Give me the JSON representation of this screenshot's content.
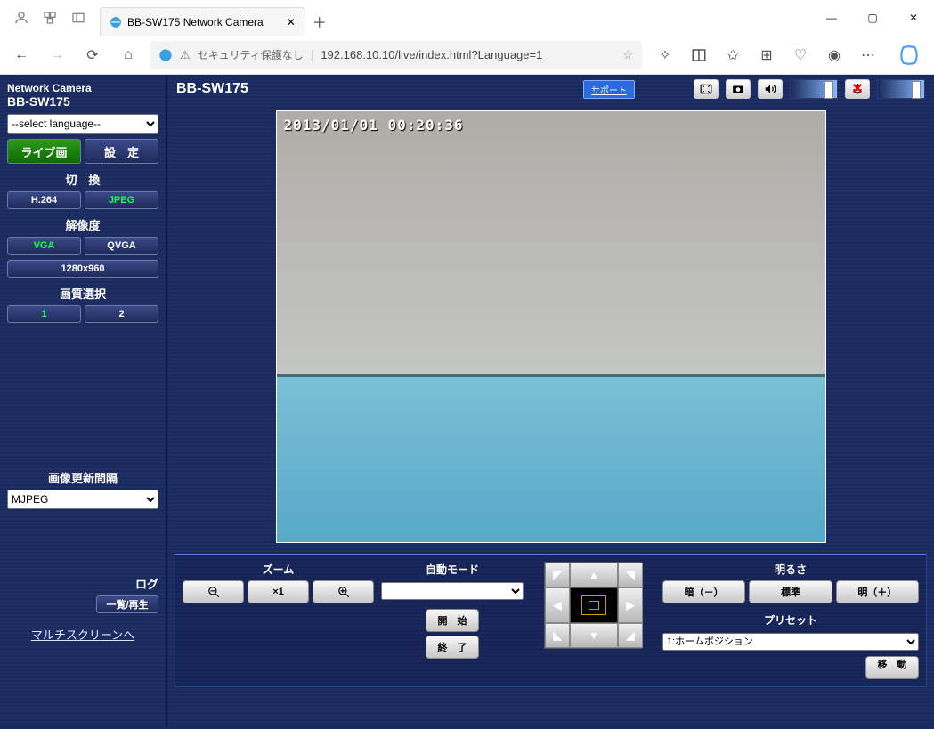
{
  "browser": {
    "tab_title": "BB-SW175 Network Camera",
    "url": "192.168.10.10/live/index.html?Language=1",
    "security_text": "セキュリティ保護なし"
  },
  "sidebar": {
    "title": "Network Camera",
    "model": "BB-SW175",
    "lang_placeholder": "--select language--",
    "live_btn": "ライブ画",
    "setup_btn": "設　定",
    "switch_label": "切　換",
    "h264": "H.264",
    "jpeg": "JPEG",
    "res_label": "解像度",
    "vga": "VGA",
    "qvga": "QVGA",
    "res3": "1280x960",
    "quality_label": "画質選択",
    "q1": "1",
    "q2": "2",
    "refresh_label": "画像更新間隔",
    "refresh_value": "MJPEG",
    "log_label": "ログ",
    "log_btn": "一覧/再生",
    "multi_link": "マルチスクリーンへ"
  },
  "main": {
    "title": "BB-SW175",
    "support": "サポート",
    "timestamp": "2013/01/01 00:20:36"
  },
  "controls": {
    "zoom_label": "ズーム",
    "zoom_x1": "×1",
    "auto_label": "自動モード",
    "start": "開　始",
    "stop": "終　了",
    "bright_label": "明るさ",
    "dark": "暗（－）",
    "normal": "標準",
    "light": "明（＋）",
    "preset_label": "プリセット",
    "preset_value": "1:ホームポジション",
    "move": "移　動"
  }
}
